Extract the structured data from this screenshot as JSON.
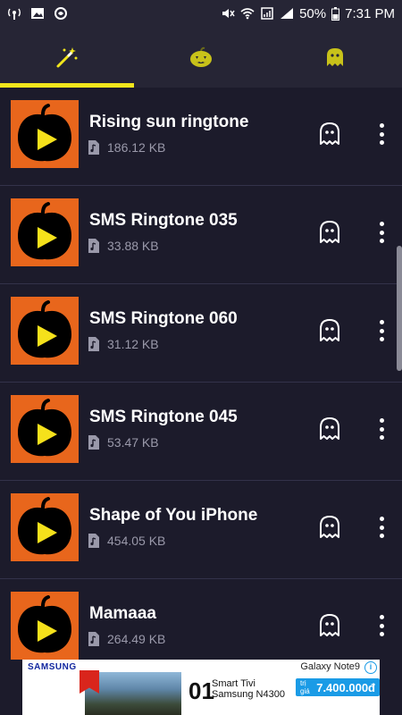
{
  "status": {
    "battery": "50%",
    "time": "7:31 PM"
  },
  "tabs": [
    {
      "icon": "magic-wand-icon",
      "selected": true
    },
    {
      "icon": "pumpkin-icon",
      "selected": false
    },
    {
      "icon": "ghost-icon",
      "selected": false
    }
  ],
  "colors": {
    "accent": "#f2e61c",
    "background": "#1c1b2b",
    "thumbnail": "#e8661c",
    "play": "#f5e11b"
  },
  "ringtones": [
    {
      "title": "Rising sun ringtone",
      "size": "186.12 KB"
    },
    {
      "title": "SMS Ringtone 035",
      "size": "33.88 KB"
    },
    {
      "title": "SMS Ringtone 060",
      "size": "31.12 KB"
    },
    {
      "title": "SMS Ringtone 045",
      "size": "53.47 KB"
    },
    {
      "title": "Shape of You iPhone",
      "size": "454.05 KB"
    },
    {
      "title": "Mamaaa",
      "size": "264.49 KB"
    }
  ],
  "ad": {
    "brand": "SAMSUNG",
    "model": "Galaxy Note9",
    "number": "01",
    "product_line1": "Smart Tivi",
    "product_line2": "Samsung N4300",
    "price_label": "trị giá",
    "price": "7.400.000đ",
    "info": "i"
  }
}
